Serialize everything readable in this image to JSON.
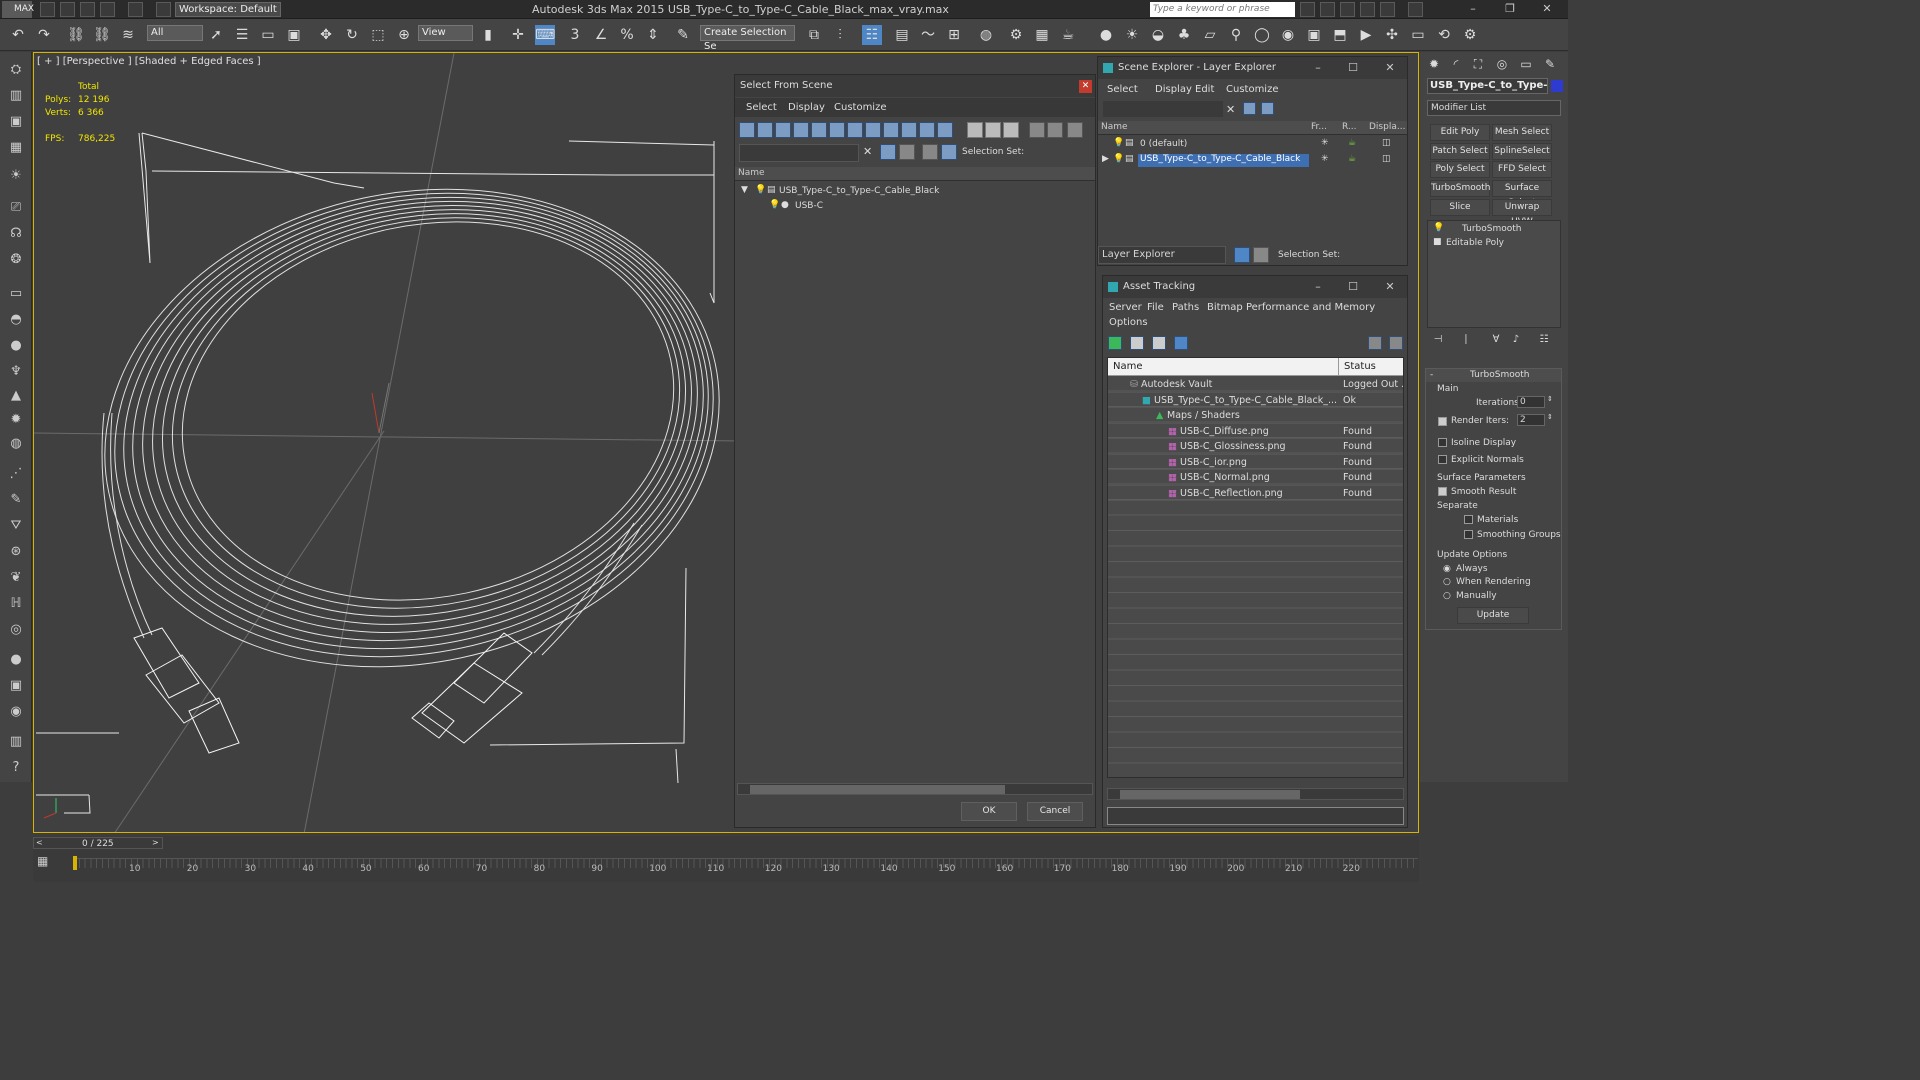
{
  "app": {
    "logo": "MAX",
    "title": "Autodesk 3ds Max  2015     USB_Type-C_to_Type-C_Cable_Black_max_vray.max",
    "workspace": "Workspace: Default",
    "search_placeholder": "Type a keyword or phrase"
  },
  "toolbar": {
    "filter": "All",
    "ref_coord": "View",
    "selection_set": "Create Selection Se",
    "snap_label": "3"
  },
  "viewport": {
    "label": "[ + ] [Perspective ] [Shaded + Edged Faces ]",
    "stats": {
      "total": "Total",
      "polys_label": "Polys:",
      "polys": "12 196",
      "verts_label": "Verts:",
      "verts": "6 366",
      "fps_label": "FPS:",
      "fps": "786,225"
    }
  },
  "select_from_scene": {
    "title": "Select From Scene",
    "menus": [
      "Select",
      "Display",
      "Customize"
    ],
    "selection_set_label": "Selection Set:",
    "col_name": "Name",
    "items": [
      {
        "label": "USB_Type-C_to_Type-C_Cable_Black"
      },
      {
        "label": "USB-C"
      }
    ],
    "ok": "OK",
    "cancel": "Cancel"
  },
  "scene_explorer": {
    "title": "Scene Explorer - Layer Explorer",
    "menus": [
      "Select",
      "Display",
      "Edit",
      "Customize"
    ],
    "cols": [
      "Name",
      "Fr...",
      "R...",
      "Displa..."
    ],
    "items": [
      {
        "label": "0 (default)"
      },
      {
        "label": "USB_Type-C_to_Type-C_Cable_Black"
      }
    ],
    "footer_dropdown": "Layer Explorer",
    "selection_set_label": "Selection Set:"
  },
  "asset_tracking": {
    "title": "Asset Tracking",
    "menus": [
      "Server",
      "File",
      "Paths",
      "Bitmap Performance and Memory",
      "Options"
    ],
    "col_name": "Name",
    "col_status": "Status",
    "rows": [
      {
        "name": "Autodesk Vault",
        "status": "Logged Out ..."
      },
      {
        "name": "USB_Type-C_to_Type-C_Cable_Black_...",
        "status": "Ok"
      },
      {
        "name": "Maps / Shaders",
        "status": ""
      },
      {
        "name": "USB-C_Diffuse.png",
        "status": "Found"
      },
      {
        "name": "USB-C_Glossiness.png",
        "status": "Found"
      },
      {
        "name": "USB-C_ior.png",
        "status": "Found"
      },
      {
        "name": "USB-C_Normal.png",
        "status": "Found"
      },
      {
        "name": "USB-C_Reflection.png",
        "status": "Found"
      }
    ]
  },
  "command_panel": {
    "object_name": "USB_Type-C_to_Type-C_",
    "modifier_list": "Modifier List",
    "buttons": [
      "Edit Poly",
      "Mesh Select",
      "Patch Select",
      "SplineSelect",
      "Poly Select",
      "FFD Select",
      "TurboSmooth",
      "Surface Select",
      "Slice",
      "Unwrap UVW"
    ],
    "stack": [
      "TurboSmooth",
      "Editable Poly"
    ],
    "rollout_title": "TurboSmooth",
    "main_label": "Main",
    "iterations_label": "Iterations:",
    "iterations": "0",
    "render_iters_label": "Render Iters:",
    "render_iters": "2",
    "isoline": "Isoline Display",
    "explicit_normals": "Explicit Normals",
    "surface_params": "Surface Parameters",
    "smooth_result": "Smooth Result",
    "separate": "Separate",
    "materials": "Materials",
    "smoothing_groups": "Smoothing Groups",
    "update_options": "Update Options",
    "always": "Always",
    "when_rendering": "When Rendering",
    "manually": "Manually",
    "update": "Update"
  },
  "timeline": {
    "frame": "0 / 225",
    "ticks": [
      "10",
      "20",
      "30",
      "40",
      "50",
      "60",
      "70",
      "80",
      "90",
      "100",
      "110",
      "120",
      "130",
      "140",
      "150",
      "160",
      "170",
      "180",
      "190",
      "200",
      "210",
      "220"
    ]
  },
  "colors": {
    "viewport_border": "#d8b300",
    "stats_text": "#f2e600",
    "selection": "#3e6fb3"
  }
}
